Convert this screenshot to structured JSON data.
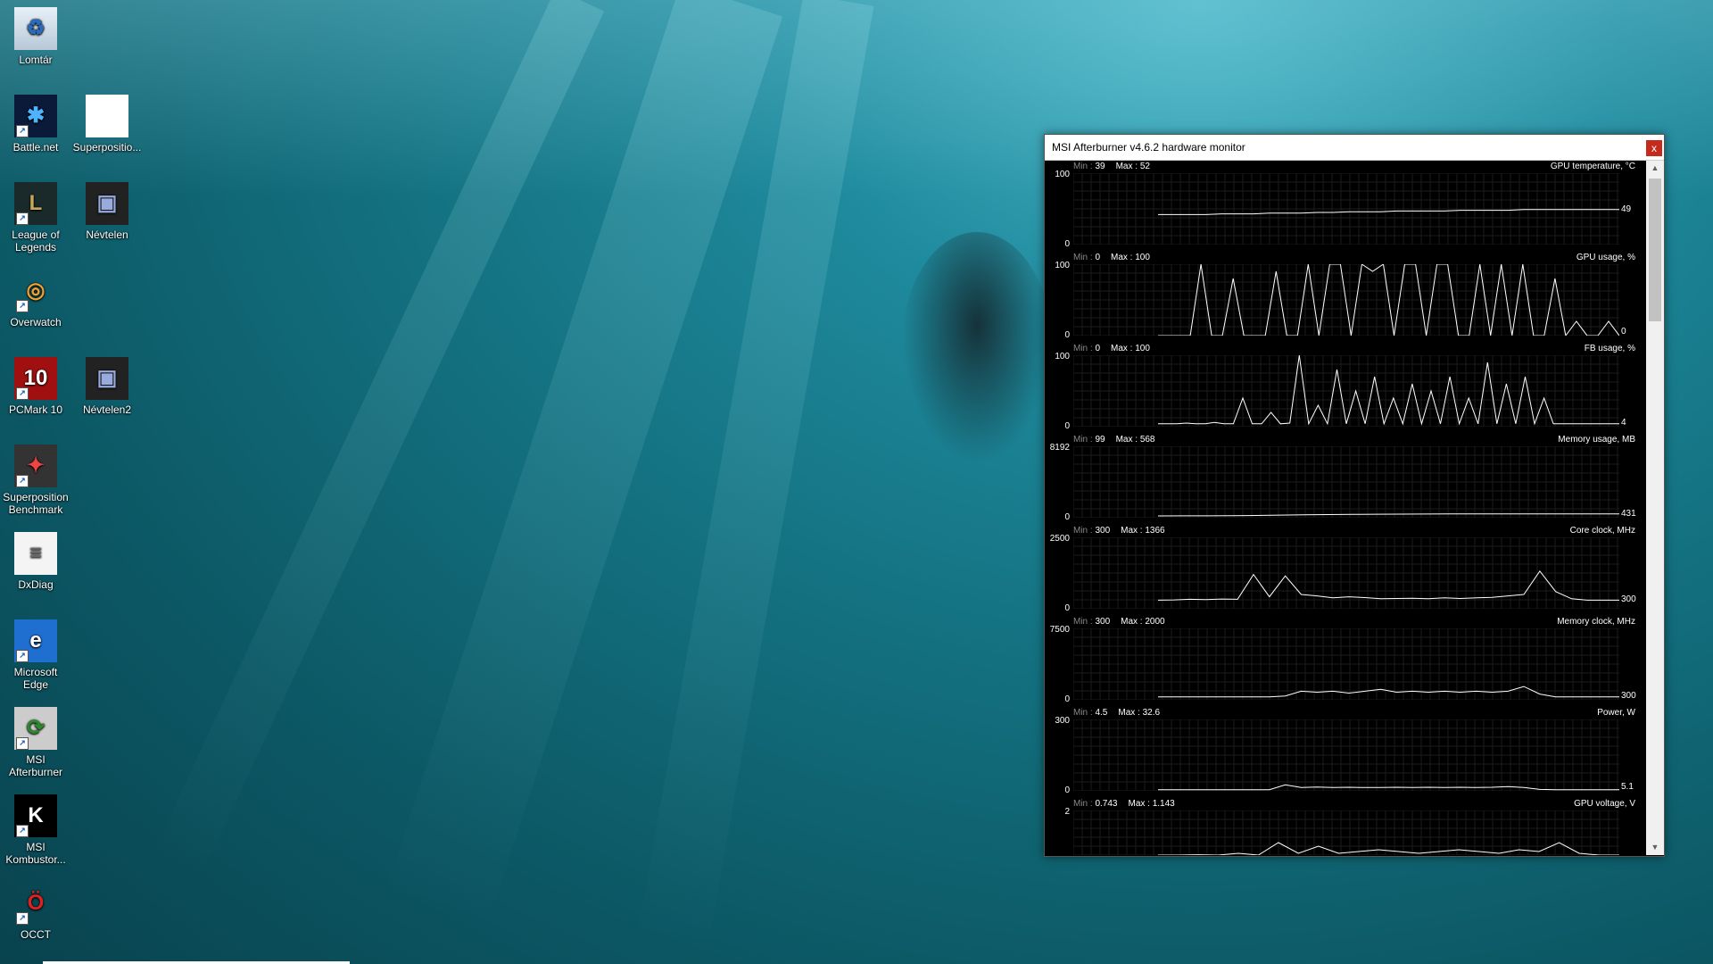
{
  "desktop": {
    "icons": [
      {
        "label": "Lomtár",
        "icon": "recycle-bin-icon"
      },
      {
        "label": "Battle.net",
        "icon": "battlenet-icon"
      },
      {
        "label": "Superpositio...",
        "icon": "document-icon"
      },
      {
        "label": "League of Legends",
        "icon": "league-of-legends-icon"
      },
      {
        "label": "Névtelen",
        "icon": "image-file-icon"
      },
      {
        "label": "Overwatch",
        "icon": "overwatch-icon"
      },
      {
        "label": "PCMark 10",
        "icon": "pcmark-icon"
      },
      {
        "label": "Névtelen2",
        "icon": "image-file-icon"
      },
      {
        "label": "Superposition Benchmark",
        "icon": "superposition-icon"
      },
      {
        "label": "DxDiag",
        "icon": "text-file-icon"
      },
      {
        "label": "Microsoft Edge",
        "icon": "edge-icon"
      },
      {
        "label": "MSI Afterburner",
        "icon": "afterburner-icon"
      },
      {
        "label": "MSI Kombustor...",
        "icon": "kombustor-icon"
      },
      {
        "label": "OCCT",
        "icon": "occt-icon"
      }
    ]
  },
  "window": {
    "title": "MSI Afterburner v4.6.2 hardware monitor",
    "close_label": "x",
    "min_label": "Min : ",
    "max_label": "Max : ",
    "graphs": [
      {
        "title": "GPU temperature, °C",
        "min": "39",
        "max": "52",
        "ymax": "100",
        "ymin": "0",
        "current": "49",
        "series": [
          42,
          42,
          42,
          42,
          43,
          43,
          43,
          44,
          44,
          44,
          45,
          45,
          46,
          46,
          46,
          47,
          47,
          47,
          47,
          48,
          48,
          48,
          48,
          49,
          49,
          49,
          49,
          49,
          49,
          49
        ]
      },
      {
        "title": "GPU usage, %",
        "min": "0",
        "max": "100",
        "ymax": "100",
        "ymin": "0",
        "current": "0",
        "series": [
          0,
          0,
          0,
          0,
          100,
          0,
          0,
          80,
          0,
          0,
          0,
          90,
          0,
          0,
          100,
          0,
          100,
          100,
          0,
          100,
          90,
          100,
          0,
          100,
          100,
          0,
          100,
          100,
          0,
          0,
          100,
          0,
          100,
          0,
          100,
          0,
          0,
          80,
          0,
          20,
          0,
          0,
          20,
          0
        ]
      },
      {
        "title": "FB usage, %",
        "min": "0",
        "max": "100",
        "ymax": "100",
        "ymin": "0",
        "current": "4",
        "series": [
          4,
          4,
          4,
          5,
          4,
          4,
          6,
          4,
          4,
          40,
          4,
          4,
          20,
          4,
          5,
          100,
          4,
          30,
          4,
          80,
          4,
          50,
          4,
          70,
          4,
          40,
          4,
          60,
          4,
          50,
          4,
          70,
          4,
          40,
          4,
          90,
          4,
          60,
          4,
          70,
          4,
          40,
          4,
          4,
          4,
          4,
          4,
          4,
          4,
          4
        ]
      },
      {
        "title": "Memory usage, MB",
        "min": "99",
        "max": "568",
        "ymax": "8192",
        "ymin": "0",
        "current": "431",
        "series": [
          200,
          210,
          220,
          230,
          260,
          300,
          330,
          360,
          380,
          400,
          410,
          420,
          425,
          430,
          431,
          431,
          431,
          431,
          431,
          431
        ]
      },
      {
        "title": "Core clock, MHz",
        "min": "300",
        "max": "1366",
        "ymax": "2500",
        "ymin": "0",
        "current": "300",
        "series": [
          300,
          310,
          330,
          320,
          340,
          330,
          1200,
          420,
          1150,
          500,
          450,
          380,
          420,
          390,
          350,
          360,
          370,
          350,
          380,
          360,
          380,
          400,
          450,
          500,
          1320,
          600,
          350,
          300,
          300,
          300
        ]
      },
      {
        "title": "Memory clock, MHz",
        "min": "300",
        "max": "2000",
        "ymax": "7500",
        "ymin": "0",
        "current": "300",
        "series": [
          300,
          300,
          300,
          300,
          300,
          300,
          300,
          300,
          400,
          900,
          800,
          900,
          700,
          900,
          1100,
          800,
          900,
          800,
          900,
          800,
          900,
          800,
          900,
          1400,
          600,
          300,
          300,
          300,
          300,
          300
        ]
      },
      {
        "title": "Power, W",
        "min": "4.5",
        "max": "32.6",
        "ymax": "300",
        "ymin": "0",
        "current": "5.1",
        "series": [
          5,
          5,
          5,
          5,
          5,
          5,
          5,
          5,
          25,
          14,
          16,
          14,
          15,
          14,
          14,
          15,
          14,
          15,
          14,
          15,
          14,
          15,
          18,
          14,
          6,
          5,
          5,
          5,
          5,
          5
        ]
      },
      {
        "title": "GPU voltage, V",
        "min": "0.743",
        "max": "1.143",
        "ymax": "2",
        "ymin": "0",
        "current": "",
        "series": [
          0.75,
          0.75,
          0.76,
          0.75,
          0.8,
          0.75,
          1.1,
          0.8,
          1.0,
          0.8,
          0.85,
          0.9,
          0.85,
          0.8,
          0.85,
          0.9,
          0.85,
          0.8,
          0.9,
          0.85,
          1.1,
          0.8,
          0.75,
          0.75
        ]
      }
    ]
  }
}
